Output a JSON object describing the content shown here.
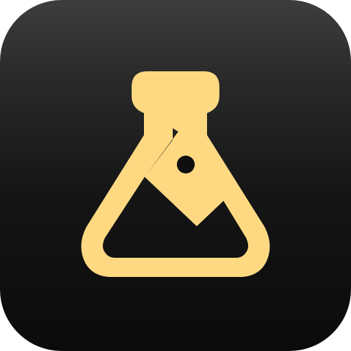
{
  "app_icon": {
    "icon": "flask-with-image-icon",
    "colors": {
      "background_top": "#3d3d3d",
      "background_bottom": "#0b0b0b",
      "symbol": "#FFD981"
    }
  }
}
